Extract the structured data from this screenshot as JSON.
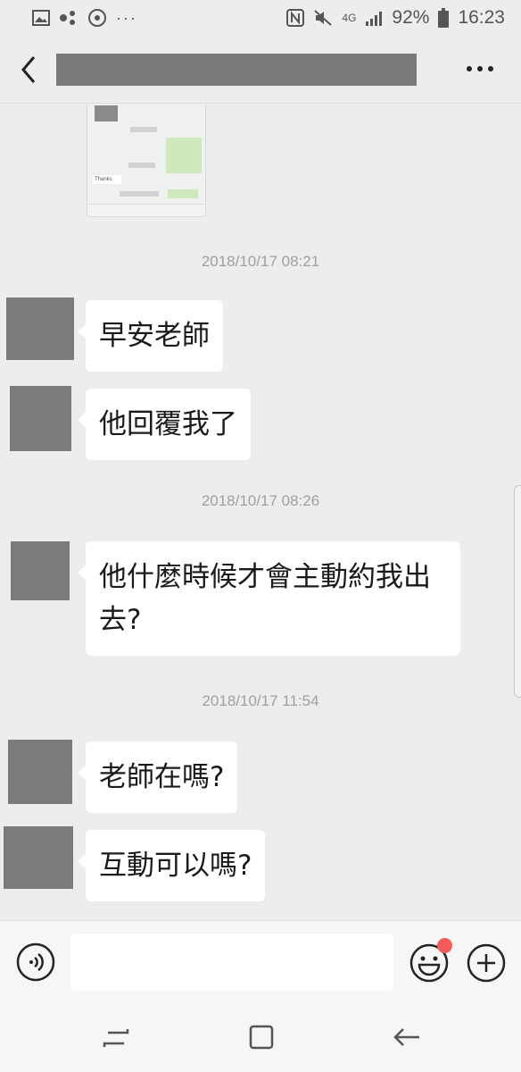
{
  "status_bar": {
    "left_icons": [
      "image-icon",
      "dots-share-icon",
      "sync-icon",
      "more-dots-icon"
    ],
    "more_dots": "···",
    "network": "4G",
    "battery": "92%",
    "time": "16:23"
  },
  "header": {
    "back_icon": "chevron-left-icon",
    "more_label": "···"
  },
  "messages": [
    {
      "type": "timestamp",
      "text": "2018/10/17 08:21"
    },
    {
      "type": "text",
      "text": "早安老師"
    },
    {
      "type": "text",
      "text": "他回覆我了"
    },
    {
      "type": "timestamp",
      "text": "2018/10/17 08:26"
    },
    {
      "type": "text",
      "text": "他什麼時候才會主動約我出去?"
    },
    {
      "type": "timestamp",
      "text": "2018/10/17 11:54"
    },
    {
      "type": "text",
      "text": "老師在嗎?"
    },
    {
      "type": "text",
      "text": "互動可以嗎?"
    }
  ],
  "thumbnail": {
    "texts": [
      "Thanks"
    ]
  },
  "input_bar": {
    "voice_icon": "voice-icon",
    "emoji_icon": "emoji-icon",
    "plus_icon": "plus-circle-icon",
    "input_value": "",
    "badge_color": "#f25c5c"
  },
  "nav_bar": {
    "icons": [
      "recent-apps-icon",
      "home-icon",
      "back-icon"
    ]
  }
}
